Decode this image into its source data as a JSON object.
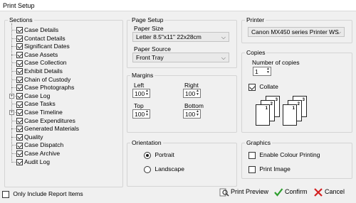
{
  "window": {
    "title": "Print Setup"
  },
  "sections": {
    "legend": "Sections",
    "items": [
      {
        "label": "Case Details",
        "checked": true,
        "expandable": false
      },
      {
        "label": "Contact Details",
        "checked": true,
        "expandable": false
      },
      {
        "label": "Significant Dates",
        "checked": true,
        "expandable": false
      },
      {
        "label": "Case Assets",
        "checked": true,
        "expandable": false
      },
      {
        "label": "Case Collection",
        "checked": true,
        "expandable": false
      },
      {
        "label": "Exhibit Details",
        "checked": true,
        "expandable": false
      },
      {
        "label": "Chain of Custody",
        "checked": true,
        "expandable": false
      },
      {
        "label": "Case Photographs",
        "checked": true,
        "expandable": false
      },
      {
        "label": "Case Log",
        "checked": true,
        "expandable": true
      },
      {
        "label": "Case Tasks",
        "checked": true,
        "expandable": false
      },
      {
        "label": "Case Timeline",
        "checked": true,
        "expandable": true
      },
      {
        "label": "Case Expenditures",
        "checked": true,
        "expandable": false
      },
      {
        "label": "Generated Materials",
        "checked": true,
        "expandable": false
      },
      {
        "label": "Quality",
        "checked": true,
        "expandable": false
      },
      {
        "label": "Case Dispatch",
        "checked": true,
        "expandable": false
      },
      {
        "label": "Case Archive",
        "checked": true,
        "expandable": false
      },
      {
        "label": "Audit Log",
        "checked": true,
        "expandable": false
      }
    ],
    "only_report_label": "Only Include Report Items"
  },
  "page_setup": {
    "legend": "Page Setup",
    "paper_size_label": "Paper Size",
    "paper_size_value": "Letter 8.5\"x11\" 22x28cm",
    "paper_source_label": "Paper Source",
    "paper_source_value": "Front Tray"
  },
  "margins": {
    "legend": "Margins",
    "left_label": "Left",
    "left_value": "100",
    "right_label": "Right",
    "right_value": "100",
    "top_label": "Top",
    "top_value": "100",
    "bottom_label": "Bottom",
    "bottom_value": "100"
  },
  "orientation": {
    "legend": "Orientation",
    "portrait_label": "Portrait",
    "landscape_label": "Landscape"
  },
  "printer": {
    "legend": "Printer",
    "value": "Canon MX450 series Printer WS"
  },
  "copies": {
    "legend": "Copies",
    "number_label": "Number of copies",
    "number_value": "1",
    "collate_label": "Collate",
    "pages": [
      "1",
      "2",
      "3",
      "1",
      "2",
      "3"
    ]
  },
  "graphics": {
    "legend": "Graphics",
    "colour_label": "Enable Colour Printing",
    "image_label": "Print Image"
  },
  "actions": {
    "preview_label": "Print Preview",
    "confirm_label": "Confirm",
    "cancel_label": "Cancel"
  },
  "colors": {
    "confirm_check": "#2e9e2e",
    "cancel_x": "#d32020"
  }
}
